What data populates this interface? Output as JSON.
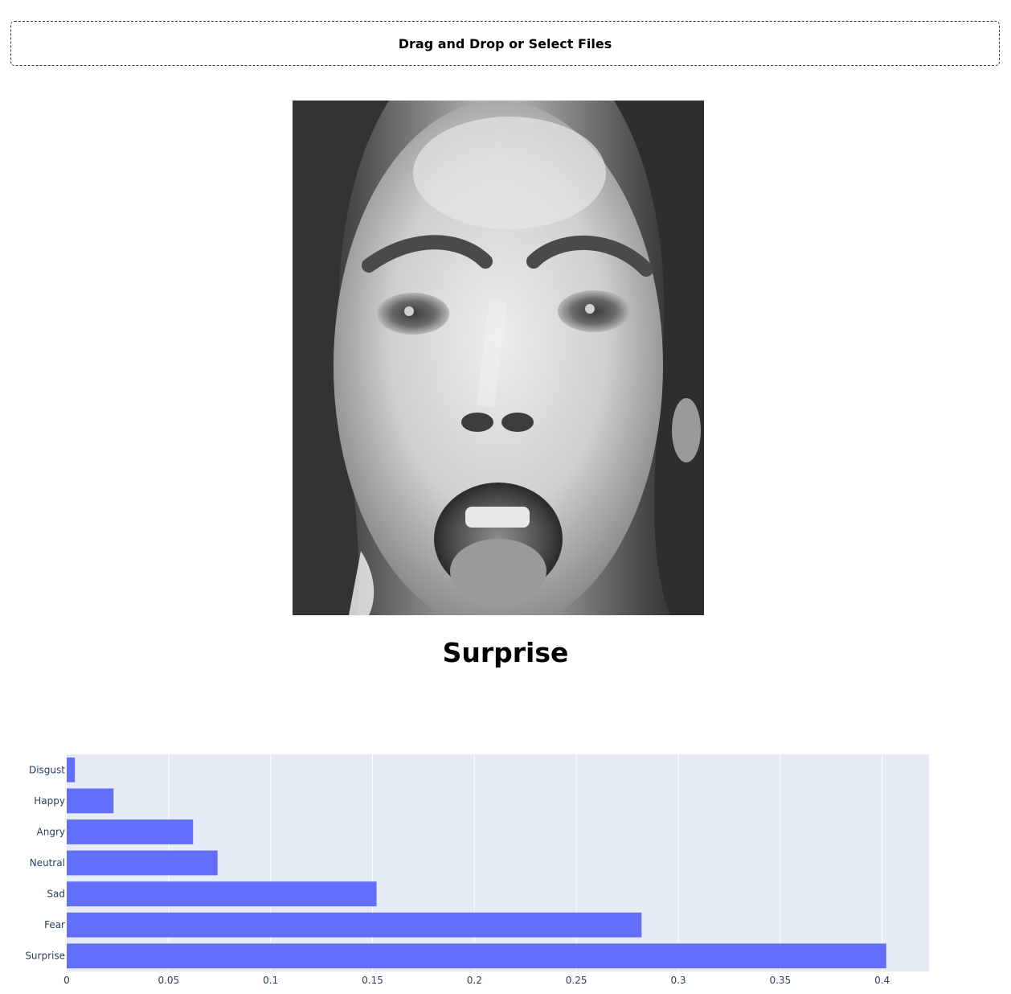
{
  "upload": {
    "label": "Drag and Drop or Select Files"
  },
  "prediction": {
    "label": "Surprise"
  },
  "colors": {
    "bar": "#636efa",
    "plot_bg": "#e5ecf6",
    "grid": "#ffffff",
    "tick_text": "#2a3f5f"
  },
  "chart_data": {
    "type": "bar",
    "orientation": "horizontal",
    "categories": [
      "Disgust",
      "Happy",
      "Angry",
      "Neutral",
      "Sad",
      "Fear",
      "Surprise"
    ],
    "values": [
      0.004,
      0.023,
      0.062,
      0.074,
      0.152,
      0.282,
      0.402
    ],
    "title": "",
    "xlabel": "",
    "ylabel": "",
    "xlim": [
      0,
      0.423
    ],
    "xticks": [
      0,
      0.05,
      0.1,
      0.15,
      0.2,
      0.25,
      0.3,
      0.35,
      0.4
    ],
    "xtick_labels": [
      "0",
      "0.05",
      "0.1",
      "0.15",
      "0.2",
      "0.25",
      "0.3",
      "0.35",
      "0.4"
    ],
    "grid": true,
    "legend": "none"
  }
}
